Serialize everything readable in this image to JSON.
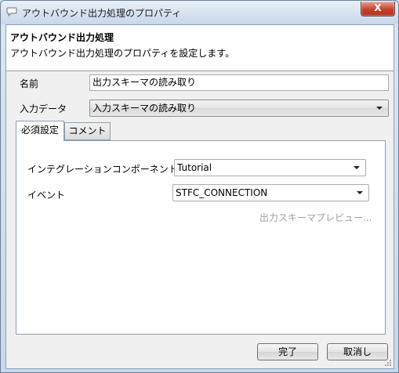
{
  "window": {
    "title": "アウトバウンド出力処理のプロパティ",
    "close_label": "X"
  },
  "header": {
    "title": "アウトバウンド出力処理",
    "description": "アウトバウンド出力処理のプロパティを設定します。"
  },
  "form": {
    "name_label": "名前",
    "name_value": "出力スキーマの読み取り",
    "input_data_label": "入力データ",
    "input_data_value": "入力スキーマの読み取り"
  },
  "tabs": [
    {
      "label": "必須設定",
      "active": true
    },
    {
      "label": "コメント",
      "active": false
    }
  ],
  "required_settings": {
    "component_label": "インテグレーションコンポーネント",
    "component_value": "Tutorial",
    "event_label": "イベント",
    "event_value": "STFC_CONNECTION",
    "preview_link": "出力スキーマプレビュー..."
  },
  "buttons": {
    "ok": "完了",
    "cancel": "取消し"
  },
  "icons": {
    "title": "speech-bubble-icon",
    "dropdown": "chevron-down-icon"
  }
}
